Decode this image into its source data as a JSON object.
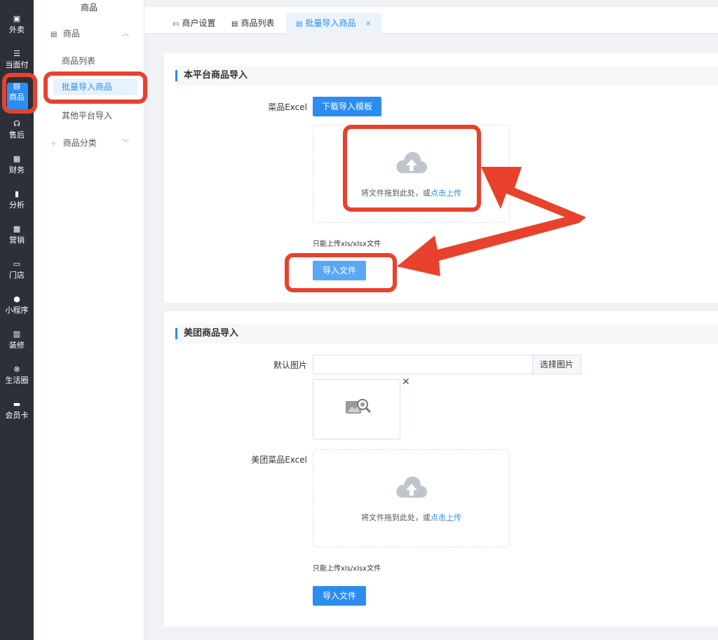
{
  "nav": {
    "items": [
      {
        "label": "外卖",
        "icon": "takeout-icon"
      },
      {
        "label": "当面付",
        "icon": "list-icon"
      },
      {
        "label": "商品",
        "icon": "basket-icon"
      },
      {
        "label": "售后",
        "icon": "headset-icon"
      },
      {
        "label": "财务",
        "icon": "finance-icon"
      },
      {
        "label": "分析",
        "icon": "bar-chart-icon"
      },
      {
        "label": "营销",
        "icon": "gift-icon"
      },
      {
        "label": "门店",
        "icon": "store-icon"
      },
      {
        "label": "小程序",
        "icon": "wechat-icon"
      },
      {
        "label": "装修",
        "icon": "decor-icon"
      },
      {
        "label": "生活圈",
        "icon": "circle-icon"
      },
      {
        "label": "会员卡",
        "icon": "card-icon"
      }
    ]
  },
  "sidebar": {
    "title": "商品",
    "group1": "商品",
    "links": [
      "商品列表",
      "批量导入商品",
      "其他平台导入"
    ],
    "group2": "商品分类"
  },
  "tabs": [
    "商户设置",
    "商品列表",
    "批量导入商品"
  ],
  "platform_import": {
    "title": "本平台商品导入",
    "excel_label": "菜品Excel",
    "download_btn": "下载导入模板",
    "drop_text": "将文件拖到此处，或",
    "drop_link": "点击上传",
    "hint": "只能上传xls/xlsx文件",
    "import_btn": "导入文件"
  },
  "meituan_import": {
    "title": "美团商品导入",
    "image_label": "默认图片",
    "image_value": "",
    "choose_btn": "选择图片",
    "excel_label": "美团菜品Excel",
    "drop_text": "将文件拖到此处，或",
    "drop_link": "点击上传",
    "hint": "只能上传xls/xlsx文件",
    "import_btn": "导入文件"
  },
  "colors": {
    "accent": "#2d8cf0",
    "nav_bg": "#2d3038",
    "annotation": "#e8412c"
  }
}
